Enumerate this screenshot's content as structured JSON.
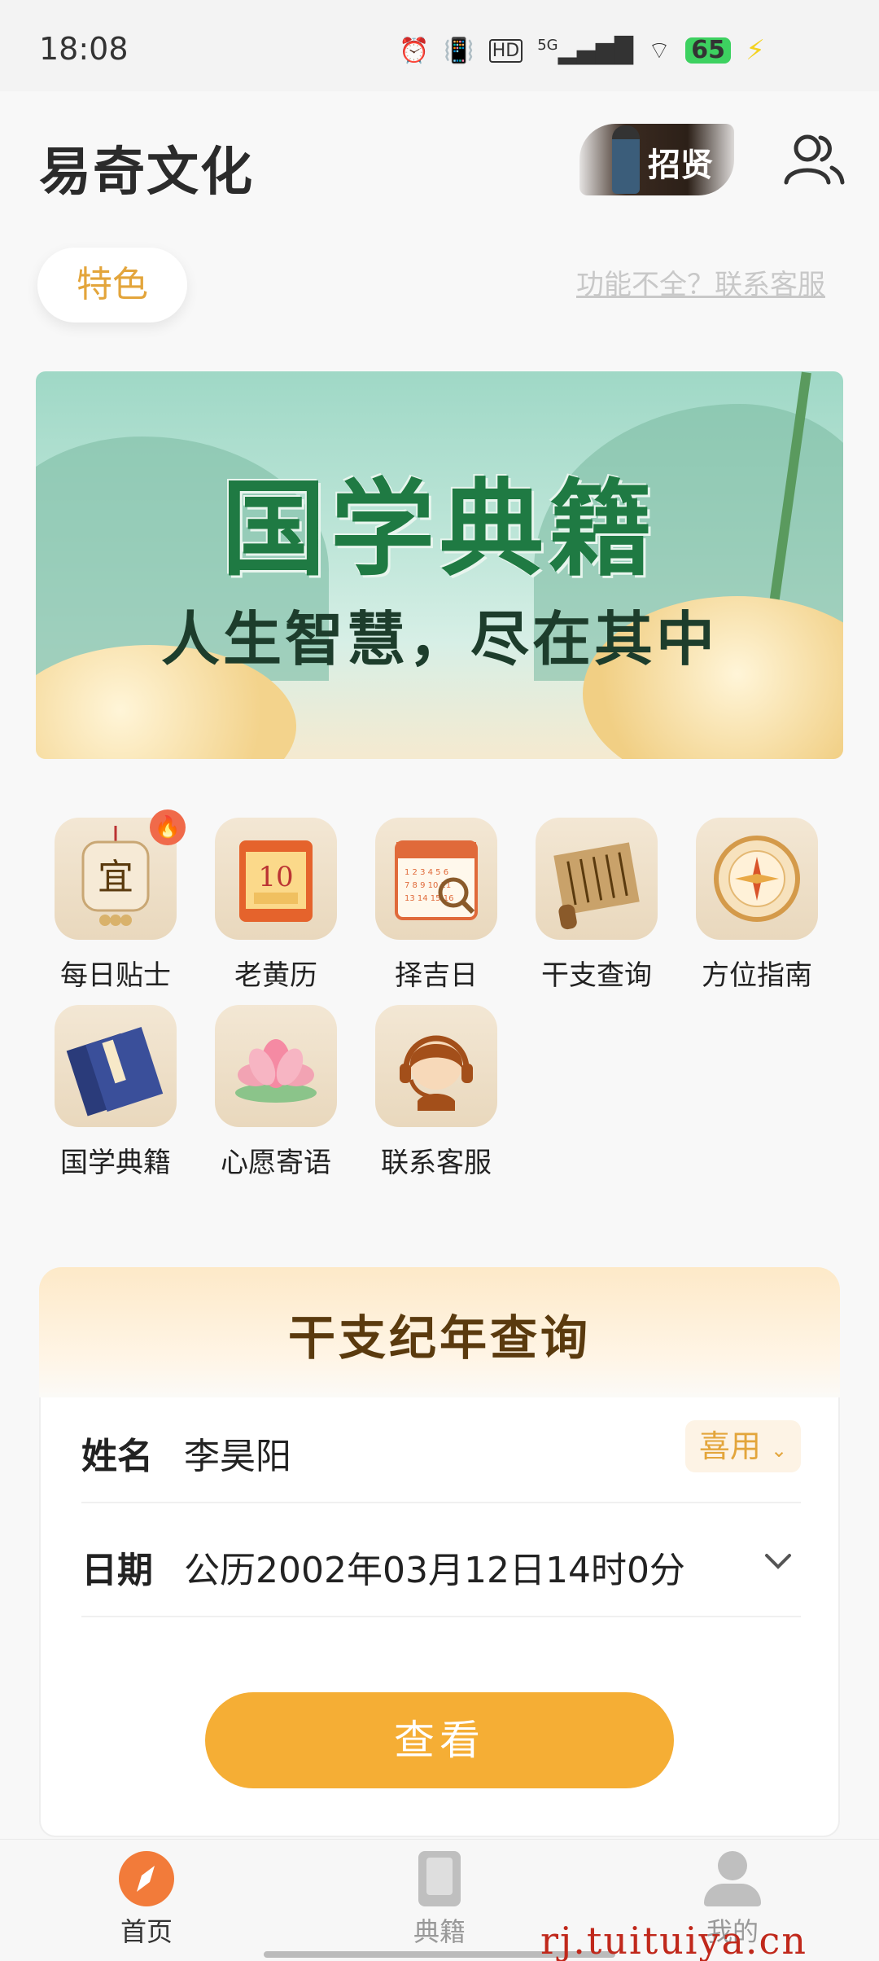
{
  "status": {
    "time": "18:08",
    "network": "5G",
    "hd": "HD",
    "battery": "65"
  },
  "header": {
    "app_title": "易奇文化",
    "recruit_label": "招贤"
  },
  "tabs": {
    "special_label": "特色",
    "support_link": "功能不全？联系客服"
  },
  "banner": {
    "title": "国学典籍",
    "subtitle": "人生智慧，尽在其中"
  },
  "features": [
    {
      "label": "每日贴士",
      "icon": "yi-seal-icon",
      "hot": true
    },
    {
      "label": "老黄历",
      "icon": "calendar-icon",
      "hot": false
    },
    {
      "label": "择吉日",
      "icon": "calendar-magnifier-icon",
      "hot": false
    },
    {
      "label": "干支查询",
      "icon": "scroll-icon",
      "hot": false
    },
    {
      "label": "方位指南",
      "icon": "compass-icon",
      "hot": false
    },
    {
      "label": "国学典籍",
      "icon": "classic-book-icon",
      "hot": false
    },
    {
      "label": "心愿寄语",
      "icon": "lotus-icon",
      "hot": false
    },
    {
      "label": "联系客服",
      "icon": "headset-agent-icon",
      "hot": false
    }
  ],
  "query_card": {
    "title": "干支纪年查询",
    "name_label": "姓名",
    "name_value": "李昊阳",
    "gender_value": "喜用",
    "date_label": "日期",
    "date_value": "公历2002年03月12日14时0分",
    "button_label": "查看"
  },
  "bottom_nav": {
    "items": [
      {
        "label": "首页",
        "active": true
      },
      {
        "label": "典籍",
        "active": false
      },
      {
        "label": "我的",
        "active": false
      }
    ]
  },
  "watermark": "rj.tuituiya.cn",
  "colors": {
    "accent": "#f5ae35",
    "accent_text": "#e3a53b",
    "banner_green": "#1f7a43",
    "home_active": "#f27b3a"
  }
}
